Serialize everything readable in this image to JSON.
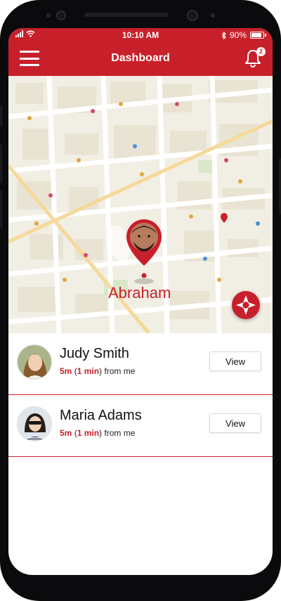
{
  "status_bar": {
    "time": "10:10 AM",
    "battery": "90%",
    "battery_level": 0.9,
    "icons": [
      "signal-icon",
      "wifi-icon",
      "bluetooth-icon",
      "battery-icon"
    ]
  },
  "header": {
    "title": "Dashboard",
    "notification_count": "2",
    "icons": [
      "hamburger-menu-icon",
      "bell-icon"
    ]
  },
  "map": {
    "pin_label": "Abraham",
    "icons": [
      "location-pin-icon",
      "compass-icon"
    ]
  },
  "contacts": [
    {
      "name": "Judy Smith",
      "distance": "5m",
      "time_open": "(",
      "time": "1 min",
      "suffix": ") from me",
      "button": "View"
    },
    {
      "name": "Maria Adams",
      "distance": "5m",
      "time_open": "(",
      "time": "1 min",
      "suffix": ") from me",
      "button": "View"
    }
  ],
  "colors": {
    "accent": "#c8202a",
    "background": "#ffffff"
  }
}
